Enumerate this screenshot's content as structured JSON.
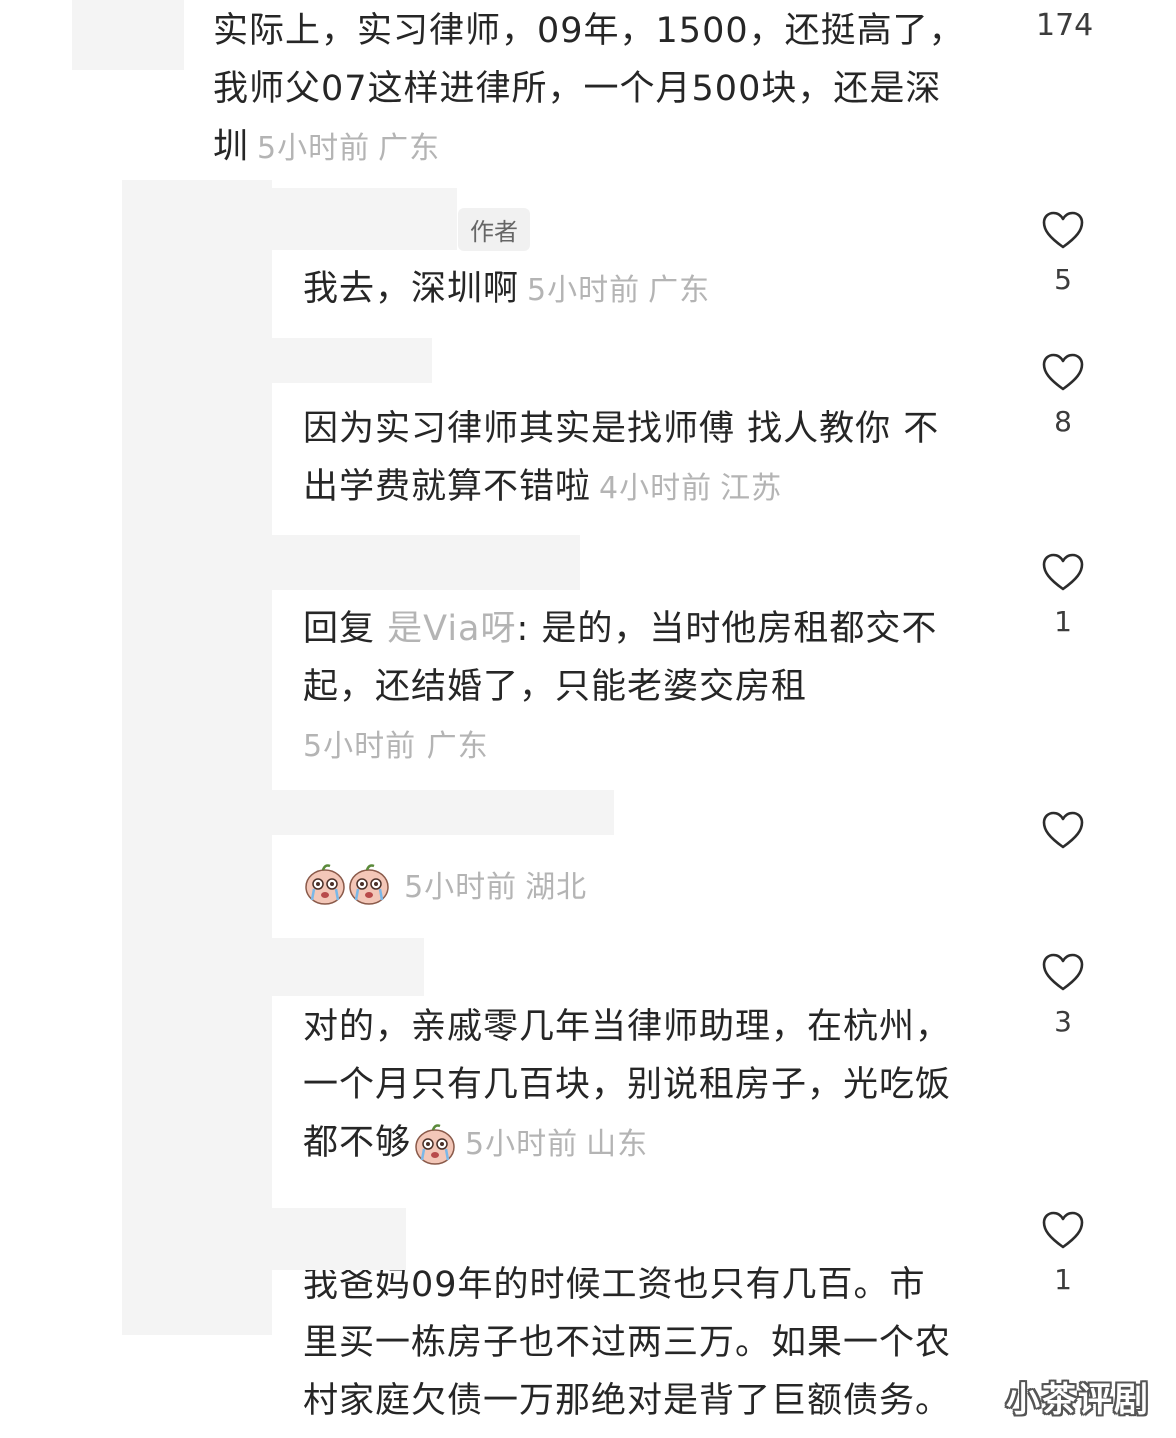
{
  "comments": [
    {
      "text": "实际上，实习律师，09年，1500，还挺高了，我师父07这样进律所，一个月500块，还是深圳",
      "lines": [
        "实际上，实习律师，09年，1500，还挺高了，",
        "我师父07这样进律所，一个月500块，还是深",
        "圳"
      ],
      "time": "5小时前",
      "location": "广东",
      "likes": "174"
    },
    {
      "badge": "作者",
      "text": "我去，深圳啊",
      "time": "5小时前",
      "location": "广东",
      "likes": "5"
    },
    {
      "text": "因为实习律师其实是找师傅 找人教你  不出学费就算不错啦",
      "lines": [
        "因为实习律师其实是找师傅 找人教你  不",
        "出学费就算不错啦"
      ],
      "time": "4小时前",
      "location": "江苏",
      "likes": "8"
    },
    {
      "reply_prefix": "回复",
      "reply_to": "是Via呀",
      "text": ": 是的，当时他房租都交不起，还结婚了，只能老婆交房租",
      "lines": [
        ": 是的，当时他房租都交不",
        "起，还结婚了，只能老婆交房租"
      ],
      "time": "5小时前",
      "location": "广东",
      "likes": "1"
    },
    {
      "emoji": "crying-face-sticker",
      "time": "5小时前",
      "location": "湖北",
      "likes": ""
    },
    {
      "text": "对的，亲戚零几年当律师助理，在杭州，一个月只有几百块，别说租房子，光吃饭都不够",
      "lines": [
        "对的，亲戚零几年当律师助理，在杭州，",
        "一个月只有几百块，别说租房子，光吃饭",
        "都不够"
      ],
      "emoji": "crying-face-sticker",
      "time": "5小时前",
      "location": "山东",
      "likes": "3"
    },
    {
      "text": "我爸妈09年的时候工资也只有几百。市里买一栋房子也不过两三万。如果一个农村家庭欠债一万那绝对是背了巨额债务。",
      "lines": [
        "我爸妈09年的时候工资也只有几百。市",
        "里买一栋房子也不过两三万。如果一个农",
        "村家庭欠债一万那绝对是背了巨额债务。"
      ],
      "likes": "1"
    }
  ],
  "watermark": "小茶评剧",
  "icons": {
    "like": "heart-outline-icon",
    "sticker": "crying-face-sticker"
  },
  "colors": {
    "text": "#262626",
    "meta": "#b4b4b4",
    "mask": "#f4f4f4"
  }
}
